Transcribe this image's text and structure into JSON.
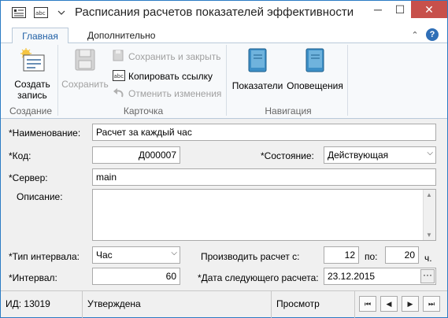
{
  "window": {
    "title": "Расписания расчетов показателей эффективности",
    "min_glyph": "─",
    "max_glyph": "☐",
    "close_glyph": "✕"
  },
  "tabs": [
    {
      "label": "Главная",
      "active": true
    },
    {
      "label": "Дополнительно",
      "active": false
    }
  ],
  "tab_controls": {
    "collapse_glyph": "⌃",
    "help_glyph": "?"
  },
  "ribbon": {
    "create": {
      "line1": "Создать",
      "line2": "запись"
    },
    "save": "Сохранить",
    "save_close": "Сохранить и закрыть",
    "copy_link": "Копировать ссылку",
    "cancel_changes": "Отменить изменения",
    "indicators": "Показатели",
    "notifications": "Оповещения",
    "groups": [
      "Создание",
      "Карточка",
      "Навигация"
    ]
  },
  "form": {
    "name_label": "*Наименование:",
    "name_value": "Расчет за каждый час",
    "code_label": "*Код:",
    "code_value": "Д000007",
    "state_label": "*Состояние:",
    "state_value": "Действующая",
    "server_label": "*Сервер:",
    "server_value": "main",
    "description_label": "Описание:",
    "description_value": "",
    "interval_type_label": "*Тип интервала:",
    "interval_type_value": "Час",
    "calc_from_label": "Производить расчет с:",
    "calc_from_value": "12",
    "calc_to_label": "по:",
    "calc_to_value": "20",
    "hours_suffix": "ч.",
    "interval_label": "*Интервал:",
    "interval_value": "60",
    "next_date_label": "*Дата следующего расчета:",
    "next_date_value": "23.12.2015",
    "ellipsis": "···"
  },
  "status": {
    "id": "ИД: 13019",
    "state": "Утверждена",
    "mode": "Просмотр"
  },
  "nav": {
    "first": "⏮",
    "prev": "◀",
    "next": "▶",
    "last": "⏭"
  }
}
